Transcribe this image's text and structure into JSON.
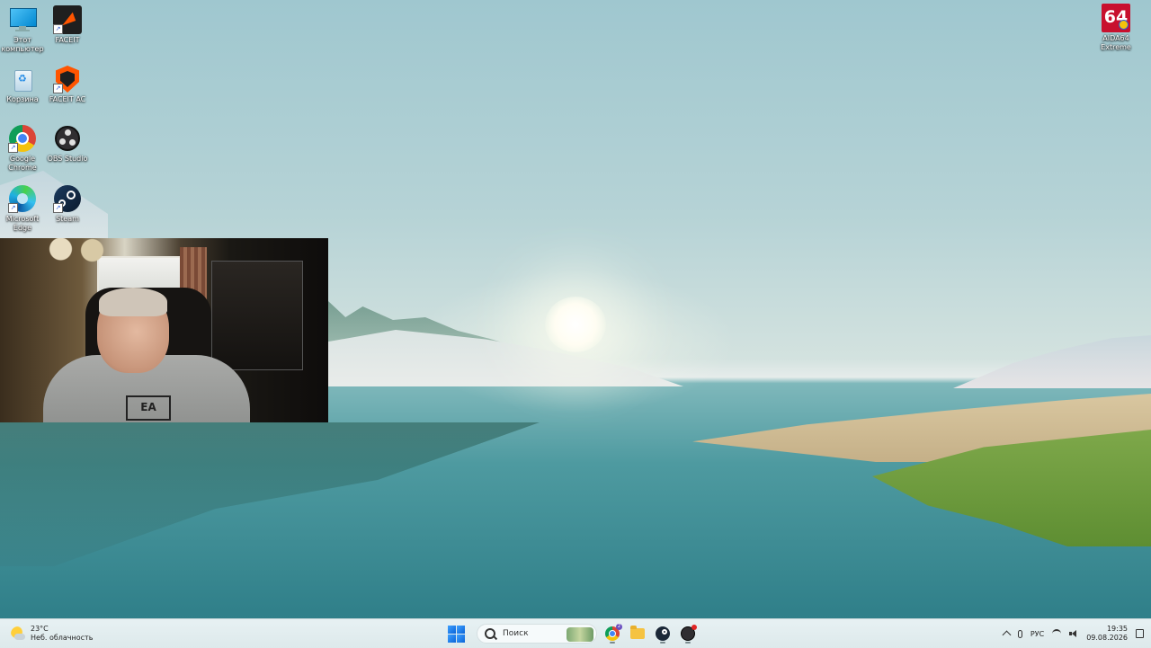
{
  "desktop": {
    "icons": [
      {
        "label": "Этот компьютер",
        "icon": "this-pc-icon"
      },
      {
        "label": "FACEIT",
        "icon": "faceit-icon"
      },
      {
        "label": "Корзина",
        "icon": "recycle-bin-icon"
      },
      {
        "label": "FACEIT AC",
        "icon": "faceit-ac-icon"
      },
      {
        "label": "Google Chrome",
        "icon": "chrome-icon"
      },
      {
        "label": "OBS Studio",
        "icon": "obs-icon"
      },
      {
        "label": "Microsoft Edge",
        "icon": "edge-icon"
      },
      {
        "label": "Steam",
        "icon": "steam-icon"
      },
      {
        "label": "AIDA64 Extreme",
        "icon": "aida64-icon",
        "badge": "64"
      }
    ]
  },
  "webcam": {
    "shirt_logo": "EA"
  },
  "taskbar": {
    "weather": {
      "temp": "23°C",
      "condition": "Неб. облачность"
    },
    "search": {
      "placeholder": "Поиск"
    },
    "apps": [
      {
        "name": "chrome-icon",
        "badge": "2"
      },
      {
        "name": "file-explorer-icon"
      },
      {
        "name": "steam-icon"
      },
      {
        "name": "obs-icon"
      }
    ],
    "tray": {
      "language": "РУС",
      "time": "19:35",
      "date": "09.08.2026"
    }
  },
  "colors": {
    "taskbar_bg": "#e7f1f3",
    "start_blue": "#0a64d8",
    "faceit_orange": "#ff5500",
    "aida_red": "#c8102e"
  }
}
